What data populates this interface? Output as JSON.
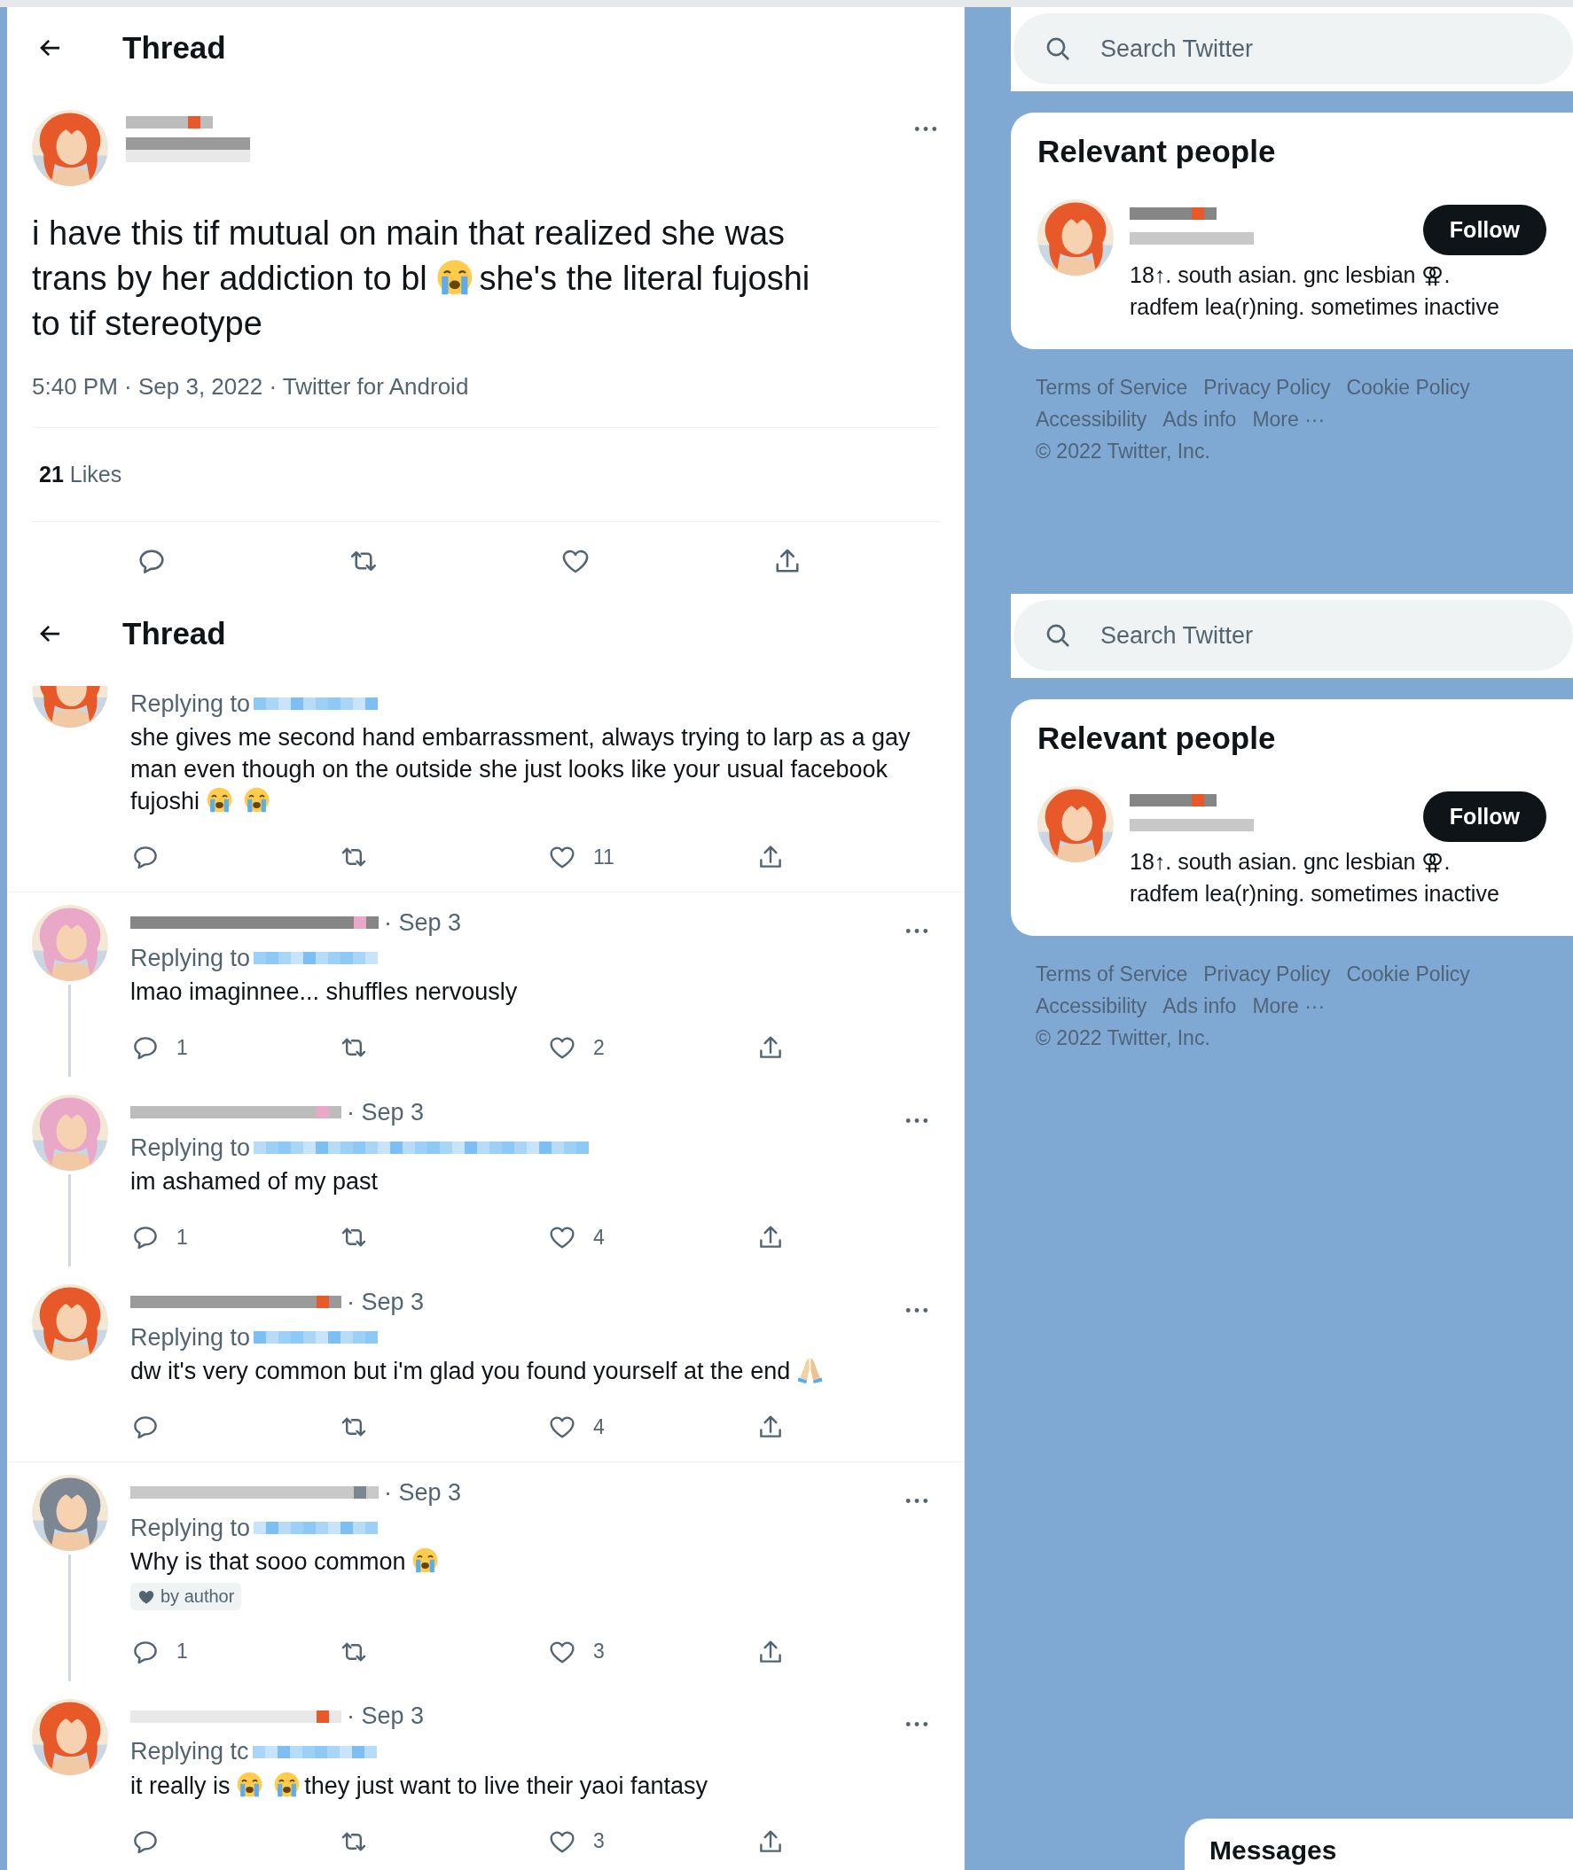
{
  "panels": [
    {
      "kind": "focused_tweet",
      "header": {
        "title": "Thread"
      },
      "tweet": {
        "avatar": {
          "kind": "picture",
          "color": "#e8592a"
        },
        "body": [
          {
            "kind": "text",
            "text": "i have this tif mutual on main that realized she was trans by her addiction to bl"
          },
          {
            "kind": "crying_face"
          },
          {
            "kind": "text",
            "text": "she's the literal fujoshi to tif stereotype"
          }
        ],
        "meta": "5:40 PM · Sep 3, 2022 · Twitter for Android",
        "likes": {
          "count": "21",
          "label": "Likes"
        }
      },
      "sidebar": {
        "search_placeholder": "Search Twitter",
        "relevant": {
          "title": "Relevant people",
          "person": {
            "avatar": {
              "kind": "picture",
              "color": "#e8592a"
            },
            "bio": "18↑. south asian. gnc lesbian ⚢. radfem lea(r)ning. sometimes inactive",
            "follow": "Follow"
          }
        },
        "footer_links": [
          "Terms of Service",
          "Privacy Policy",
          "Cookie Policy",
          "Accessibility",
          "Ads info",
          "More ···"
        ],
        "copyright": "© 2022 Twitter, Inc."
      }
    },
    {
      "kind": "replies",
      "header": {
        "title": "Thread"
      },
      "replies": [
        {
          "avatar": {
            "kind": "picture",
            "color": "#e8592a"
          },
          "avatar_partly_hidden": true,
          "replying_label": "Replying to",
          "body": [
            {
              "kind": "text",
              "text": "she gives me second hand embarrassment, always trying to larp as a gay man even though on the outside she just looks like your usual facebook fujoshi"
            },
            {
              "kind": "crying_face"
            },
            {
              "kind": "crying_face"
            }
          ],
          "likes_count": "11",
          "thread_line": false
        },
        {
          "avatar": {
            "kind": "picture",
            "color": "#e9a8c8"
          },
          "avatar_partly_hidden": false,
          "date": "· Sep 3",
          "replying_label": "Replying to",
          "body": [
            {
              "kind": "text",
              "text": "lmao imaginnee... shuffles nervously"
            }
          ],
          "replies_count": "1",
          "likes_count": "2",
          "thread_line": true
        },
        {
          "avatar": {
            "kind": "picture",
            "color": "#e9a8c8"
          },
          "avatar_partly_hidden": false,
          "date": "· Sep 3",
          "replying_label": "Replying to",
          "body": [
            {
              "kind": "text",
              "text": "im ashamed of my past"
            }
          ],
          "replies_count": "1",
          "likes_count": "4",
          "thread_line": true
        },
        {
          "avatar": {
            "kind": "picture",
            "color": "#e8592a"
          },
          "avatar_partly_hidden": false,
          "date": "· Sep 3",
          "replying_label": "Replying to",
          "body": [
            {
              "kind": "text",
              "text": "dw it's very common but i'm glad you found yourself at the end"
            },
            {
              "kind": "folded_hands"
            }
          ],
          "likes_count": "4",
          "thread_line": false
        },
        {
          "avatar": {
            "kind": "picture",
            "color": "#7d8794"
          },
          "avatar_partly_hidden": false,
          "date": "· Sep 3",
          "replying_label": "Replying to",
          "body": [
            {
              "kind": "text",
              "text": "Why is that sooo common"
            },
            {
              "kind": "crying_face"
            }
          ],
          "liked_by_author": "by author",
          "replies_count": "1",
          "likes_count": "3",
          "thread_line": true
        },
        {
          "avatar": {
            "kind": "picture",
            "color": "#e8592a"
          },
          "avatar_partly_hidden": false,
          "date": "· Sep 3",
          "replying_label": "Replying tc",
          "body": [
            {
              "kind": "text",
              "text": "it really is"
            },
            {
              "kind": "crying_face"
            },
            {
              "kind": "crying_face"
            },
            {
              "kind": "text",
              "text": "they just want to live their yaoi fantasy"
            }
          ],
          "likes_count": "3",
          "thread_line": false
        }
      ],
      "sidebar": {
        "search_placeholder": "Search Twitter",
        "relevant": {
          "title": "Relevant people",
          "person": {
            "avatar": {
              "kind": "picture",
              "color": "#e8592a"
            },
            "bio": "18↑. south asian. gnc lesbian ⚢. radfem lea(r)ning. sometimes inactive",
            "follow": "Follow"
          }
        },
        "footer_links": [
          "Terms of Service",
          "Privacy Policy",
          "Cookie Policy",
          "Accessibility",
          "Ads info",
          "More ···"
        ],
        "copyright": "© 2022 Twitter, Inc."
      },
      "messages": "Messages"
    }
  ]
}
